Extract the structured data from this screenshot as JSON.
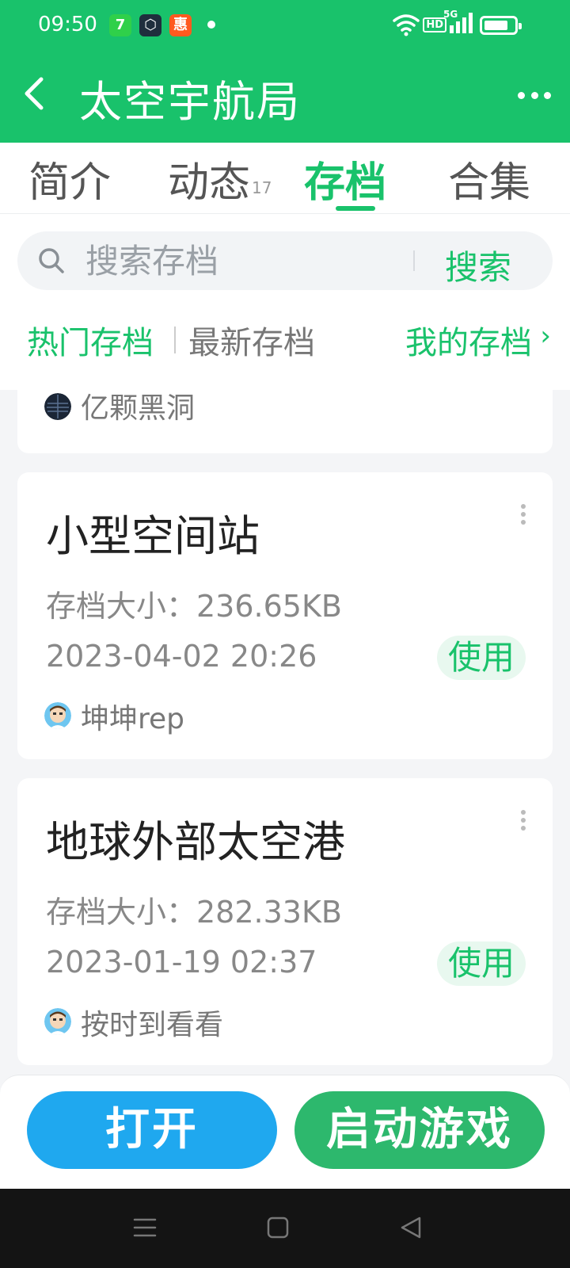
{
  "status_bar": {
    "time": "09:50",
    "hd_label": "HD",
    "network_label": "5G",
    "app_icons": [
      "7",
      "⬡",
      "惠"
    ]
  },
  "header": {
    "title": "太空宇航局"
  },
  "tabs": [
    {
      "label": "简介",
      "badge": ""
    },
    {
      "label": "动态",
      "badge": "17"
    },
    {
      "label": "存档",
      "badge": ""
    },
    {
      "label": "合集",
      "badge": ""
    }
  ],
  "active_tab": "存档",
  "search": {
    "placeholder": "搜索存档",
    "button_label": "搜索"
  },
  "filters": {
    "hot": "热门存档",
    "latest": "最新存档",
    "mine": "我的存档"
  },
  "saves": [
    {
      "title": "",
      "size_label": "",
      "date": "",
      "author": "亿颗黑洞",
      "use_label": ""
    },
    {
      "title": "小型空间站",
      "size_label": "存档大小：236.65KB",
      "date": "2023-04-02 20:26",
      "author": "坤坤rep",
      "use_label": "使用"
    },
    {
      "title": "地球外部太空港",
      "size_label": "存档大小：282.33KB",
      "date": "2023-01-19 02:37",
      "author": "按时到看看",
      "use_label": "使用"
    }
  ],
  "bottom": {
    "open_label": "打开",
    "launch_label": "启动游戏"
  },
  "colors": {
    "brand_green": "#19c26b",
    "open_blue": "#1fa8ef",
    "launch_green": "#2db86d"
  }
}
